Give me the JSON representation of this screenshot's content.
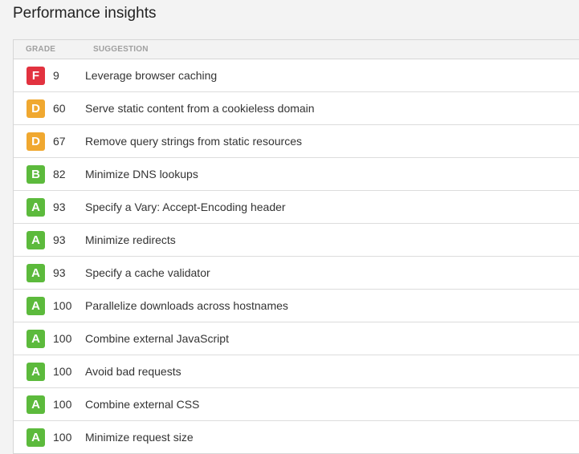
{
  "title": "Performance insights",
  "headers": {
    "grade": "GRADE",
    "suggestion": "SUGGESTION"
  },
  "grade_colors": {
    "A": "#5cba3c",
    "B": "#5cba3c",
    "D": "#f0a830",
    "F": "#e2323f"
  },
  "rows": [
    {
      "grade": "F",
      "score": "9",
      "suggestion": "Leverage browser caching"
    },
    {
      "grade": "D",
      "score": "60",
      "suggestion": "Serve static content from a cookieless domain"
    },
    {
      "grade": "D",
      "score": "67",
      "suggestion": "Remove query strings from static resources"
    },
    {
      "grade": "B",
      "score": "82",
      "suggestion": "Minimize DNS lookups"
    },
    {
      "grade": "A",
      "score": "93",
      "suggestion": "Specify a Vary: Accept-Encoding header"
    },
    {
      "grade": "A",
      "score": "93",
      "suggestion": "Minimize redirects"
    },
    {
      "grade": "A",
      "score": "93",
      "suggestion": "Specify a cache validator"
    },
    {
      "grade": "A",
      "score": "100",
      "suggestion": "Parallelize downloads across hostnames"
    },
    {
      "grade": "A",
      "score": "100",
      "suggestion": "Combine external JavaScript"
    },
    {
      "grade": "A",
      "score": "100",
      "suggestion": "Avoid bad requests"
    },
    {
      "grade": "A",
      "score": "100",
      "suggestion": "Combine external CSS"
    },
    {
      "grade": "A",
      "score": "100",
      "suggestion": "Minimize request size"
    }
  ]
}
